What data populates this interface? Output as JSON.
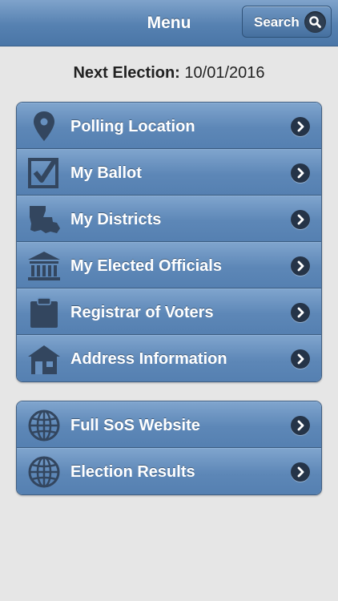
{
  "header": {
    "title": "Menu",
    "search_label": "Search"
  },
  "next_election": {
    "label": "Next Election:",
    "date": "10/01/2016"
  },
  "main_menu": [
    {
      "label": "Polling Location",
      "icon": "map-pin-icon"
    },
    {
      "label": "My Ballot",
      "icon": "ballot-checkbox-icon"
    },
    {
      "label": "My Districts",
      "icon": "louisiana-map-icon"
    },
    {
      "label": "My Elected Officials",
      "icon": "capitol-building-icon"
    },
    {
      "label": "Registrar of Voters",
      "icon": "clipboard-icon"
    },
    {
      "label": "Address Information",
      "icon": "house-icon"
    }
  ],
  "secondary_menu": [
    {
      "label": "Full SoS Website",
      "icon": "globe-icon"
    },
    {
      "label": "Election Results",
      "icon": "globe-icon"
    }
  ],
  "colors": {
    "header_blue": "#5681b1",
    "item_blue": "#6790bf",
    "background": "#e6e6e6",
    "icon_dark": "#33465f"
  }
}
